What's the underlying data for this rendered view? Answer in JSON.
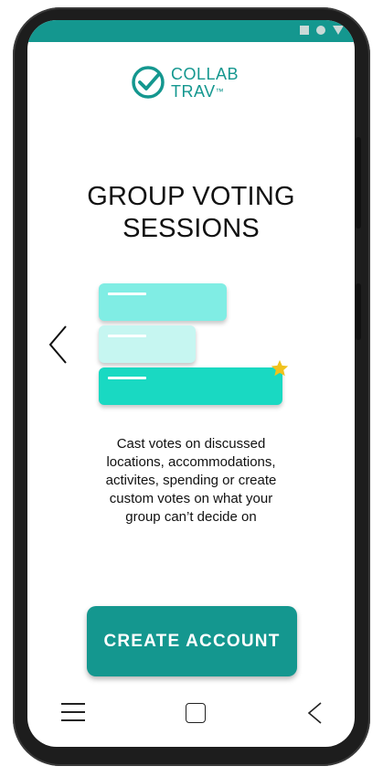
{
  "app": {
    "logo_line1": "COLLAB",
    "logo_line2": "TRAV",
    "logo_tm": "™",
    "brand_color": "#14978f"
  },
  "onboarding": {
    "title_line1": "GROUP VOTING",
    "title_line2": "SESSIONS",
    "description_lines": [
      "Cast votes on discussed",
      "locations, accommodations,",
      "activites, spending or create",
      "custom votes on what your",
      "group can’t decide on"
    ],
    "illustration": {
      "cards": [
        {
          "color": "#80ede4"
        },
        {
          "color": "#c6f6f1"
        },
        {
          "color": "#19d9c2"
        }
      ],
      "star_color": "#f0c21d"
    }
  },
  "cta": {
    "create_account_label": "CREATE ACCOUNT"
  },
  "icons": {
    "status": [
      "square-icon",
      "circle-icon",
      "triangle-icon"
    ],
    "nav": [
      "menu-icon",
      "home-icon",
      "back-icon"
    ],
    "prev_slide": "chevron-left-icon"
  }
}
